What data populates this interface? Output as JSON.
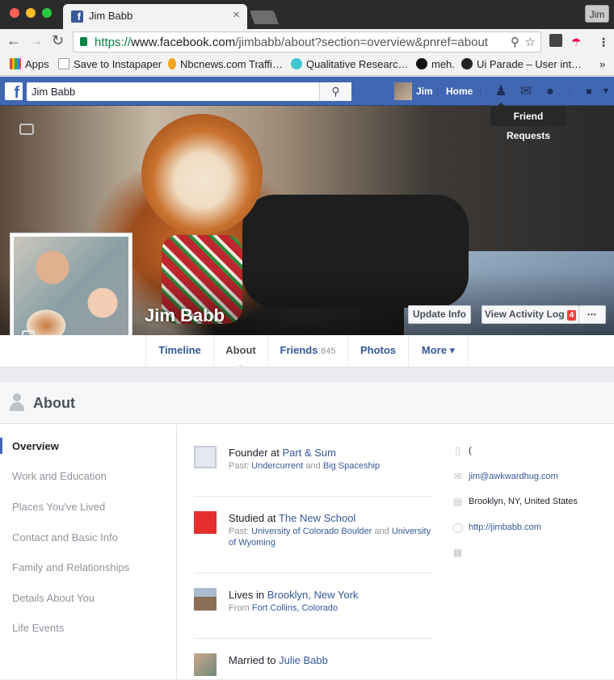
{
  "browser": {
    "tab_title": "Jim Babb",
    "tab_close": "×",
    "profile_label": "Jim",
    "url_scheme": "https://",
    "url_host": "www.facebook.com",
    "url_path": "/jimbabb/about?section=overview&pnref=about",
    "bookmarks": [
      {
        "label": "Apps",
        "color": "#ea4335"
      },
      {
        "label": "Save to Instapaper",
        "color": "#ffffff"
      },
      {
        "label": "Nbcnews.com Traffi…",
        "color": "#f6a623"
      },
      {
        "label": "Qualitative Researc…",
        "color": "#3fc7d0"
      },
      {
        "label": "meh.",
        "color": "#111111"
      },
      {
        "label": "Ui Parade – User int…",
        "color": "#222222"
      }
    ],
    "bookmarks_overflow": "»"
  },
  "fb": {
    "search_value": "Jim Babb",
    "user_name": "Jim",
    "home_label": "Home",
    "tooltip": "Friend Requests"
  },
  "profile": {
    "name": "Jim Babb",
    "update_info": "Update Info",
    "activity_log": "View Activity Log",
    "activity_count": "4",
    "more_dots": "•••"
  },
  "timeline_nav": {
    "timeline": "Timeline",
    "about": "About",
    "friends": "Friends",
    "friends_count": "845",
    "photos": "Photos",
    "more": "More ▾"
  },
  "about": {
    "title": "About",
    "side_items": [
      "Overview",
      "Work and Education",
      "Places You've Lived",
      "Contact and Basic Info",
      "Family and Relationships",
      "Details About You",
      "Life Events"
    ],
    "work": {
      "prefix": "Founder at",
      "company": "Part & Sum",
      "past_label": "Past:",
      "past1": "Undercurrent",
      "and": "and",
      "past2": "Big Spaceship"
    },
    "education": {
      "prefix": "Studied at",
      "school": "The New School",
      "past_label": "Past:",
      "past1": "University of Colorado Boulder",
      "and": "and",
      "past2": "University of Wyoming"
    },
    "lives": {
      "prefix": "Lives in",
      "city": "Brooklyn, New York",
      "from_label": "From",
      "from": "Fort Collins, Colorado"
    },
    "married": {
      "prefix": "Married to",
      "spouse": "Julie Babb"
    },
    "contact": {
      "phone": "(",
      "email": "jim@awkwardhug.com",
      "location": "Brooklyn, NY, United States",
      "website": "http://jimbabb.com"
    }
  }
}
